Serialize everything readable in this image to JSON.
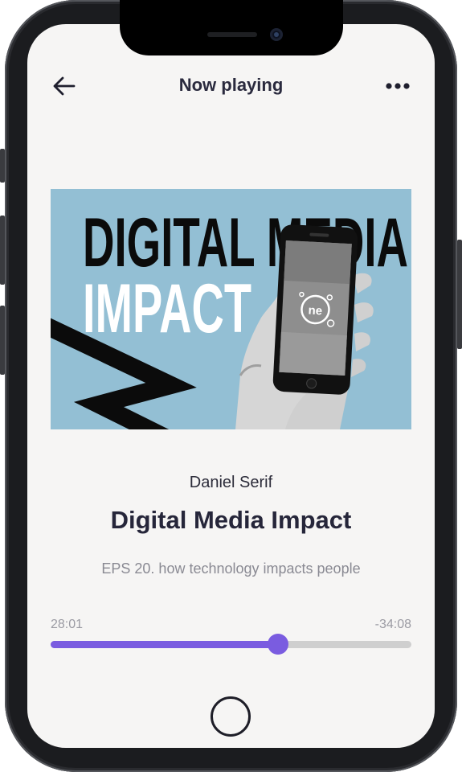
{
  "header": {
    "title": "Now playing",
    "back_icon": "arrow-left-icon",
    "more_icon": "more-horizontal-icon"
  },
  "artwork": {
    "line1": "DIGITAL MEDIA",
    "line2": "IMPACT",
    "logo_text": "ne"
  },
  "episode": {
    "artist": "Daniel Serif",
    "title": "Digital Media Impact",
    "subtitle": "EPS 20. how technology impacts people"
  },
  "player": {
    "elapsed": "28:01",
    "remaining": "-34:08",
    "progress": 0.63
  },
  "colors": {
    "accent": "#7a5ce0",
    "background": "#f6f5f4",
    "text_dark": "#26263a",
    "text_muted": "#8a8a93",
    "cover_bg": "#93bfd4"
  }
}
